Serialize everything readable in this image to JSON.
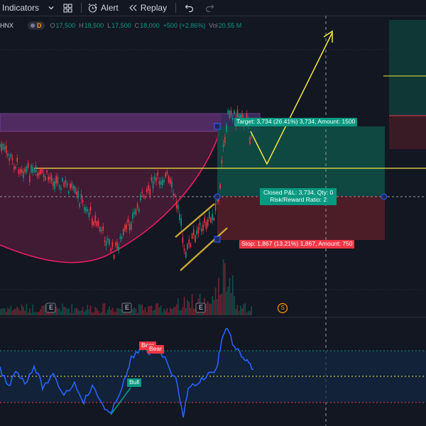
{
  "toolbar": {
    "indicators_label": "Indicators",
    "alert_label": "Alert",
    "replay_label": "Replay",
    "icons": [
      "chevron-down-icon",
      "layout-grid-icon",
      "alarm-clock-icon",
      "replay-icon",
      "undo-icon",
      "redo-icon"
    ]
  },
  "legend": {
    "symbol": "HNX",
    "badge": "D",
    "o_key": "O",
    "o_val": "17,500",
    "h_key": "H",
    "h_val": "18,500",
    "l_key": "L",
    "l_val": "17,500",
    "c_key": "C",
    "c_val": "18,000",
    "change": "+500 (+2.86%)",
    "vol_key": "Vol",
    "vol_val": "20.55 M"
  },
  "position": {
    "target_label": "Target: 3,734 (26.41%) 3,734, Amount: 1500",
    "closed_label": "Closed P&L: 3,734, Qty: 0",
    "rr_label": "Risk/Reward Ratio: 2",
    "stop_label": "Stop: 1,867 (13.21%) 1,867, Amount: 750"
  },
  "oscillator": {
    "bear_label_1": "Bear",
    "bear_label_2": "Bear",
    "bull_label": "Bull"
  },
  "markers": {
    "earnings": [
      "E",
      "E",
      "E"
    ],
    "dividend": "S"
  },
  "colors": {
    "background": "#131722",
    "up": "#089981",
    "down": "#f23645",
    "cup": "#e91e63",
    "target_zone": "#0f4c45",
    "stop_zone": "#4f1d27",
    "rsi_line": "#2962ff",
    "annotation_yellow": "#f5e642",
    "target_box": "#5c3a8a"
  }
}
